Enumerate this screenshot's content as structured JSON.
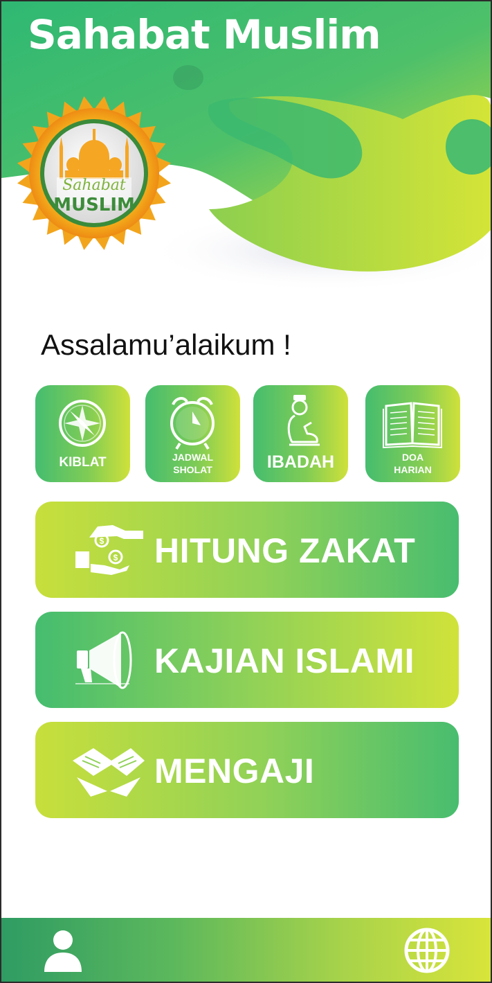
{
  "app": {
    "title": "Sahabat Muslim"
  },
  "logo": {
    "line1": "Sahabat",
    "line2": "MUSLIM"
  },
  "greeting": "Assalamu’alaikum !",
  "menu_tiles": [
    {
      "label": "KIBLAT",
      "icon": "compass-icon"
    },
    {
      "label": "JADWAL\nSHOLAT",
      "icon": "alarm-clock-icon"
    },
    {
      "label": "IBADAH",
      "icon": "praying-person-icon"
    },
    {
      "label": "DOA\nHARIAN",
      "icon": "open-book-icon"
    }
  ],
  "wide_buttons": [
    {
      "label": "HITUNG ZAKAT",
      "icon": "giving-coins-icon"
    },
    {
      "label": "KAJIAN ISLAMI",
      "icon": "megaphone-icon"
    },
    {
      "label": "MENGAJI",
      "icon": "quran-stand-icon"
    }
  ],
  "bottom_nav": {
    "left_icon": "user-icon",
    "right_icon": "globe-icon"
  },
  "colors": {
    "primary_green": "#45bd6f",
    "lime": "#cfe13a",
    "accent_orange": "#f5a623"
  }
}
